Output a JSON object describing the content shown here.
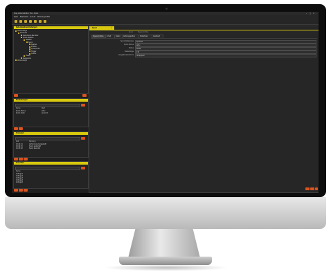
{
  "window": {
    "title": "dbsp Administration Tool - Spool",
    "controls": [
      "–",
      "□",
      "×"
    ]
  },
  "menu": [
    "Datei",
    "Bearbeiten",
    "Ansicht",
    "Werkzeuge",
    "Hilfe"
  ],
  "left_panels": {
    "tree": {
      "title": "Datenbankverbindungen",
      "items": [
        {
          "label": "Verbindung1",
          "depth": 0
        },
        {
          "label": "Schemas",
          "depth": 1
        },
        {
          "label": "Datenbank-Benutzer",
          "depth": 2
        },
        {
          "label": "Spool-Dateien",
          "depth": 2
        },
        {
          "label": "Tabellen",
          "depth": 3
        },
        {
          "label": "Spool",
          "depth": 4
        },
        {
          "label": "Spalten",
          "depth": 5
        },
        {
          "label": "Indizes",
          "depth": 5
        },
        {
          "label": "Constraints",
          "depth": 5
        },
        {
          "label": "Trigger",
          "depth": 5
        },
        {
          "label": "Grants",
          "depth": 5
        },
        {
          "label": "Views",
          "depth": 3
        },
        {
          "label": "Sequenzen",
          "depth": 2
        },
        {
          "label": "Verbindung2",
          "depth": 0
        }
      ]
    },
    "panel2": {
      "title": "Einstellungen",
      "columns": [
        "Name",
        "Wert"
      ],
      "rows": [
        [
          "Spool-Modus",
          "aktiv"
        ],
        [
          "Spool-Datei",
          "spool.lst"
        ]
      ]
    },
    "panel3": {
      "title": "Protokoll",
      "columns": [
        "Zeit",
        "Meldung"
      ],
      "rows": [
        [
          "10:42:11",
          "Verbindung hergestellt"
        ],
        [
          "10:42:15",
          "Spool gestartet"
        ],
        [
          "10:43:02",
          "Spool beendet"
        ]
      ]
    },
    "panel4": {
      "title": "Favoriten",
      "column": "Name",
      "rows": [
        "Abfrage1",
        "Abfrage2",
        "Abfrage3",
        "Abfrage4",
        "Abfrage5"
      ]
    }
  },
  "main": {
    "tab_label": "Spool",
    "crumb": [
      "Spool",
      "Eigenschaften"
    ],
    "subtabs": [
      "Eigenschaften",
      "Inhalt",
      "Daten",
      "Abhängigkeiten",
      "Statistiken",
      "Quelltext"
    ],
    "fields": [
      {
        "label": "Spool-Dateiname",
        "value": "spool.lst"
      },
      {
        "label": "Spool-Modus",
        "value": "aktiv"
      },
      {
        "label": "Status",
        "value": "bereit"
      },
      {
        "label": "Zeilenlänge",
        "value": "132"
      },
      {
        "label": "Ausgabeverzeichnis",
        "value": "/tmp/spool"
      }
    ]
  }
}
